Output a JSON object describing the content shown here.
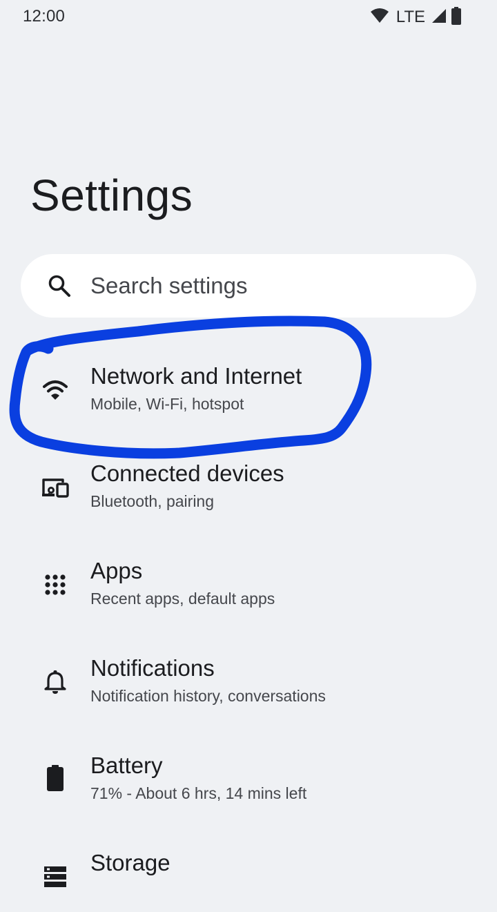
{
  "status_bar": {
    "time": "12:00",
    "network_label": "LTE",
    "icons": [
      "wifi-icon",
      "cell-signal-icon",
      "battery-icon"
    ]
  },
  "page": {
    "title": "Settings"
  },
  "search": {
    "placeholder": "Search settings",
    "icon": "search-icon"
  },
  "settings": {
    "items": [
      {
        "title": "Network and Internet",
        "subtitle": "Mobile, Wi-Fi, hotspot",
        "icon": "wifi-icon"
      },
      {
        "title": "Connected devices",
        "subtitle": "Bluetooth, pairing",
        "icon": "connected-devices-icon"
      },
      {
        "title": "Apps",
        "subtitle": "Recent apps, default apps",
        "icon": "apps-grid-icon"
      },
      {
        "title": "Notifications",
        "subtitle": "Notification history, conversations",
        "icon": "bell-icon"
      },
      {
        "title": "Battery",
        "subtitle": "71% - About 6 hrs, 14 mins left",
        "icon": "battery-icon"
      },
      {
        "title": "Storage",
        "subtitle": "",
        "icon": "storage-icon"
      }
    ]
  },
  "colors": {
    "background": "#eff1f4",
    "search_background": "#ffffff",
    "annotation": "#0a3fe0",
    "text_primary": "#1b1c1f",
    "text_secondary": "#45474c"
  }
}
